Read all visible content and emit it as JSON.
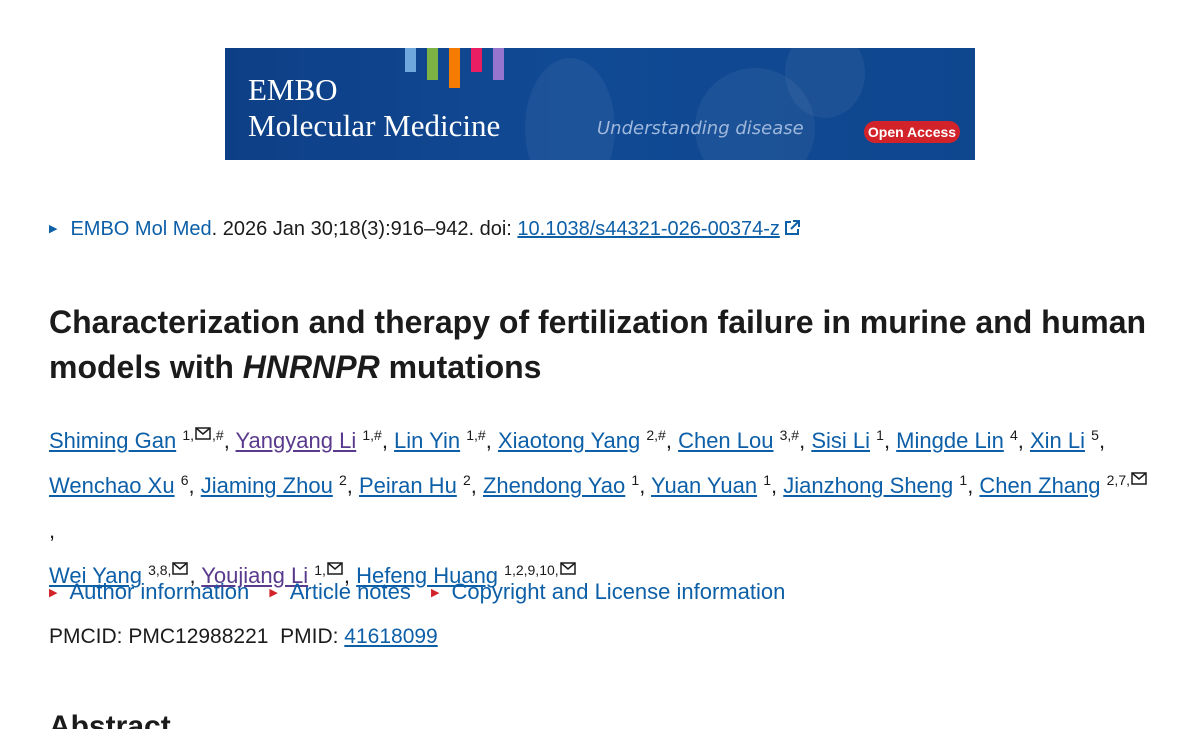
{
  "banner": {
    "line1": "EMBO",
    "line2": "Molecular Medicine",
    "tagline": "Understanding disease",
    "badge": "Open Access",
    "bar_colors": [
      "#6fa8dc",
      "#7cb342",
      "#f57c00",
      "#e91e63",
      "#9575cd"
    ]
  },
  "citation": {
    "journal": "EMBO Mol Med",
    "details": ". 2026 Jan 30;18(3):916–942. doi: ",
    "doi": "10.1038/s44321-026-00374-z"
  },
  "title": {
    "part1": "Characterization and therapy of fertilization failure in murine and human models with ",
    "gene": "HNRNPR",
    "part2": " mutations"
  },
  "authors": [
    {
      "name": "Shiming Gan",
      "sup_pre": "1,",
      "mail": true,
      "sup_post": ",#",
      "visited": false
    },
    {
      "name": "Yangyang Li",
      "sup_pre": "1,#",
      "mail": false,
      "sup_post": "",
      "visited": true
    },
    {
      "name": "Lin Yin",
      "sup_pre": "1,#",
      "mail": false,
      "sup_post": "",
      "visited": false
    },
    {
      "name": "Xiaotong Yang",
      "sup_pre": "2,#",
      "mail": false,
      "sup_post": "",
      "visited": false
    },
    {
      "name": "Chen Lou",
      "sup_pre": "3,#",
      "mail": false,
      "sup_post": "",
      "visited": false
    },
    {
      "name": "Sisi Li",
      "sup_pre": "1",
      "mail": false,
      "sup_post": "",
      "visited": false
    },
    {
      "name": "Mingde Lin",
      "sup_pre": "4",
      "mail": false,
      "sup_post": "",
      "visited": false
    },
    {
      "name": "Xin Li",
      "sup_pre": "5",
      "mail": false,
      "sup_post": "",
      "visited": false
    },
    {
      "name": "Wenchao Xu",
      "sup_pre": "6",
      "mail": false,
      "sup_post": "",
      "visited": false
    },
    {
      "name": "Jiaming Zhou",
      "sup_pre": "2",
      "mail": false,
      "sup_post": "",
      "visited": false
    },
    {
      "name": "Peiran Hu",
      "sup_pre": "2",
      "mail": false,
      "sup_post": "",
      "visited": false
    },
    {
      "name": "Zhendong Yao",
      "sup_pre": "1",
      "mail": false,
      "sup_post": "",
      "visited": false
    },
    {
      "name": "Yuan Yuan",
      "sup_pre": "1",
      "mail": false,
      "sup_post": "",
      "visited": false
    },
    {
      "name": "Jianzhong Sheng",
      "sup_pre": "1",
      "mail": false,
      "sup_post": "",
      "visited": false
    },
    {
      "name": "Chen Zhang",
      "sup_pre": "2,7,",
      "mail": true,
      "sup_post": "",
      "visited": false
    },
    {
      "name": "Wei Yang",
      "sup_pre": "3,8,",
      "mail": true,
      "sup_post": "",
      "visited": false
    },
    {
      "name": "Youjiang Li",
      "sup_pre": "1,",
      "mail": true,
      "sup_post": "",
      "visited": true
    },
    {
      "name": "Hefeng Huang",
      "sup_pre": "1,2,9,10,",
      "mail": true,
      "sup_post": "",
      "visited": false
    }
  ],
  "toggles": [
    "Author information",
    "Article notes",
    "Copyright and License information"
  ],
  "ids": {
    "pmcid_label": "PMCID: ",
    "pmcid": "PMC12988221",
    "pmid_label": "PMID: ",
    "pmid": "41618099"
  },
  "abstract_heading": "Abstract"
}
